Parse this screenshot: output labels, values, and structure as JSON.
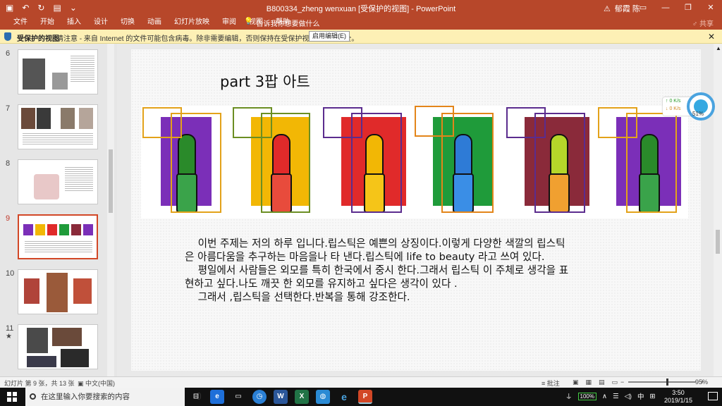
{
  "window": {
    "doc_title": "B800334_zheng wenxuan [受保护的视图] - PowerPoint",
    "user_name": "郁霞 陈",
    "share_label": "♂ 共享"
  },
  "ribbon": {
    "tabs": [
      "文件",
      "开始",
      "插入",
      "设计",
      "切换",
      "动画",
      "幻灯片放映",
      "审阅",
      "视图",
      "帮助"
    ],
    "tell_me": "告诉我你想要做什么"
  },
  "protected_view": {
    "title": "受保护的视图",
    "message": "请注意 - 来自 Internet 的文件可能包含病毒。除非需要编辑，否则保持在受保护视图中比较安全。",
    "enable_label": "启用编辑(E)"
  },
  "thumbnails": [
    {
      "num": "6",
      "star": "",
      "active": false
    },
    {
      "num": "7",
      "star": "",
      "active": false
    },
    {
      "num": "8",
      "star": "",
      "active": false
    },
    {
      "num": "9",
      "star": "",
      "active": true
    },
    {
      "num": "10",
      "star": "",
      "active": false
    },
    {
      "num": "11",
      "star": "★",
      "active": false
    }
  ],
  "slide": {
    "title": "part 3팝 아트",
    "body": "    이번 주제는 저의 하루 입니다.립스틱은 예쁜의 상징이다.이렇게 다양한 색깔의 립스틱\n은 아름다움을 추구하는 마음을나 타 낸다.립스틱에 life to beauty 라고 쓰여 있다.\n    평일에서 사람들은 외모를 특히 한국에서 중시 한다.그래서 립스틱 이 주체로 생각을 표\n현하고 싶다.나도 깨끗 한 외모를 유지하고 싶다은 생각이 있다 .\n    그래서 ,립스틱을 선택한다.반복을 통해 강조한다.",
    "panels": [
      {
        "bg": "#7b2fb8",
        "lip": "#2a8a2a",
        "cap": "#3aa34a",
        "o1": "#e3a21a",
        "o2": "#e3a21a"
      },
      {
        "bg": "#f2b705",
        "lip": "#e02a2a",
        "cap": "#e84b3c",
        "o1": "#6b8e23",
        "o2": "#6b8e23"
      },
      {
        "bg": "#e02a2a",
        "lip": "#f2b705",
        "cap": "#f5c518",
        "o1": "#5b2c8e",
        "o2": "#5b2c8e"
      },
      {
        "bg": "#1f9b3a",
        "lip": "#2e7bd6",
        "cap": "#3a8ee6",
        "o1": "#e3851a",
        "o2": "#e3851a"
      },
      {
        "bg": "#8a2a3a",
        "lip": "#b5d62a",
        "cap": "#f0a030",
        "o1": "#5b2c8e",
        "o2": "#5b2c8e"
      },
      {
        "bg": "#7b2fb8",
        "lip": "#2a8a2a",
        "cap": "#3aa34a",
        "o1": "#e3a21a",
        "o2": "#e3a21a"
      }
    ]
  },
  "widget": {
    "up": "↑ 0  K/s",
    "down": "↓ 0  K/s",
    "percent": "51%"
  },
  "status": {
    "slide_info": "幻灯片 第 9 张，共 13 张",
    "language": "中文(中国)",
    "notes_label": "批注",
    "zoom": "95%"
  },
  "taskbar": {
    "search_placeholder": "在这里输入你要搜索的内容",
    "ime": "中",
    "time": "3:50",
    "date": "2019/1/15",
    "battery": "100%"
  }
}
